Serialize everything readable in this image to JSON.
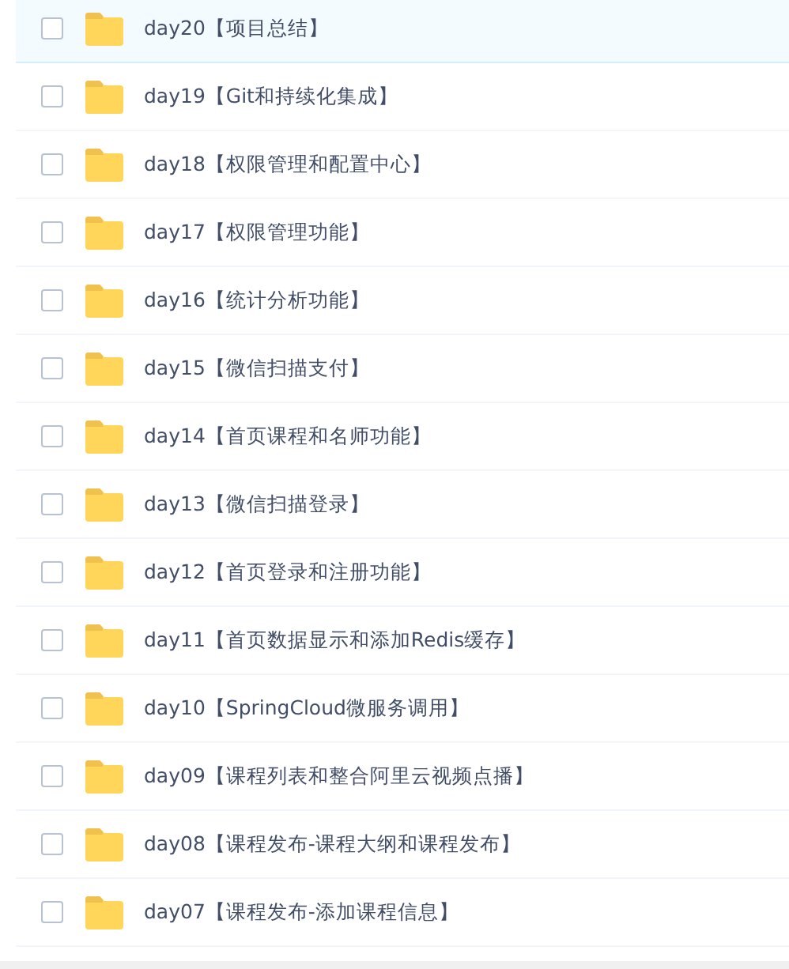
{
  "files": [
    {
      "name": "day20【项目总结】",
      "selected": true,
      "checked": false
    },
    {
      "name": "day19【Git和持续化集成】",
      "selected": false,
      "checked": false
    },
    {
      "name": "day18【权限管理和配置中心】",
      "selected": false,
      "checked": false
    },
    {
      "name": "day17【权限管理功能】",
      "selected": false,
      "checked": false
    },
    {
      "name": "day16【统计分析功能】",
      "selected": false,
      "checked": false
    },
    {
      "name": "day15【微信扫描支付】",
      "selected": false,
      "checked": false
    },
    {
      "name": "day14【首页课程和名师功能】",
      "selected": false,
      "checked": false
    },
    {
      "name": "day13【微信扫描登录】",
      "selected": false,
      "checked": false
    },
    {
      "name": "day12【首页登录和注册功能】",
      "selected": false,
      "checked": false
    },
    {
      "name": "day11【首页数据显示和添加Redis缓存】",
      "selected": false,
      "checked": false
    },
    {
      "name": "day10【SpringCloud微服务调用】",
      "selected": false,
      "checked": false
    },
    {
      "name": "day09【课程列表和整合阿里云视频点播】",
      "selected": false,
      "checked": false
    },
    {
      "name": "day08【课程发布-课程大纲和课程发布】",
      "selected": false,
      "checked": false
    },
    {
      "name": "day07【课程发布-添加课程信息】",
      "selected": false,
      "checked": false
    }
  ]
}
